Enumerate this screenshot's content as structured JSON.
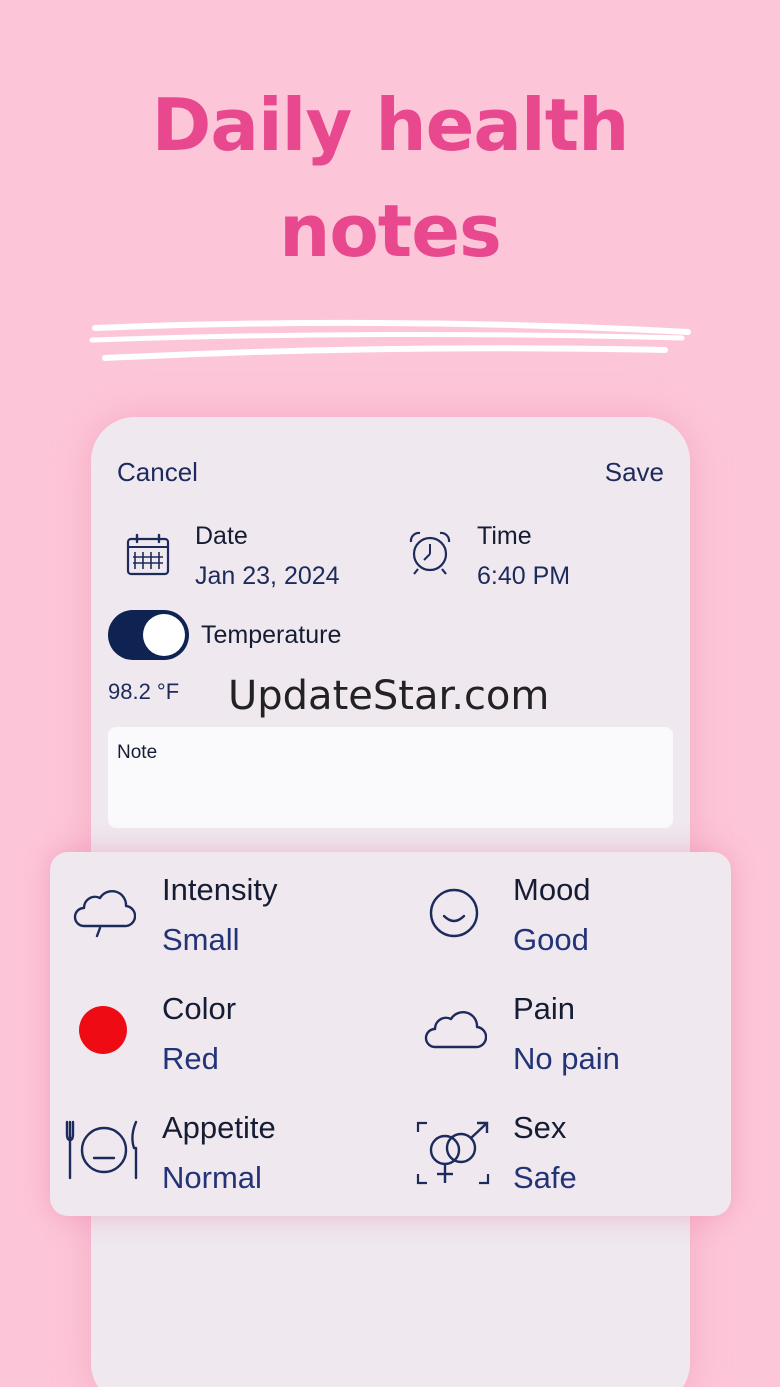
{
  "headline": {
    "line1": "Daily health",
    "line2": "notes"
  },
  "topbar": {
    "cancel_label": "Cancel",
    "save_label": "Save"
  },
  "date": {
    "label": "Date",
    "value": "Jan 23, 2024"
  },
  "time": {
    "label": "Time",
    "value": "6:40 PM"
  },
  "temperature": {
    "label": "Temperature",
    "enabled": true,
    "value": "98.2 °F"
  },
  "watermark": "UpdateStar.com",
  "note": {
    "placeholder": "Note"
  },
  "details": [
    {
      "title": "Intensity",
      "value": "Small",
      "icon": "cloud-drizzle-icon"
    },
    {
      "title": "Mood",
      "value": "Good",
      "icon": "smile-icon"
    },
    {
      "title": "Color",
      "value": "Red",
      "icon": "red-dot-icon",
      "color": "#ee0b14"
    },
    {
      "title": "Pain",
      "value": "No pain",
      "icon": "cloud-icon"
    },
    {
      "title": "Appetite",
      "value": "Normal",
      "icon": "plate-cutlery-icon"
    },
    {
      "title": "Sex",
      "value": "Safe",
      "icon": "gender-symbols-icon"
    }
  ],
  "colors": {
    "background": "#fdc6d8",
    "accent": "#e8488e",
    "navy": "#0f2353"
  }
}
